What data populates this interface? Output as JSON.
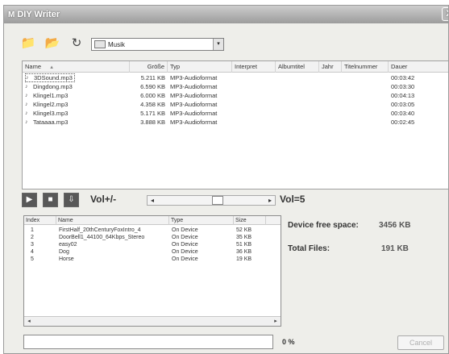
{
  "window": {
    "title": "DIY Writer",
    "app_icon": "M",
    "close": "X"
  },
  "toolbar": {
    "folder_combo_value": "Musik",
    "combo_arrow": "▾"
  },
  "file_list": {
    "columns": [
      "Name",
      "Größe",
      "Typ",
      "Interpret",
      "Albumtitel",
      "Jahr",
      "Titelnummer",
      "Dauer"
    ],
    "sort_indicator": "▲",
    "rows": [
      {
        "name": "3DSound.mp3",
        "size": "5.211 KB",
        "type": "MP3-Audioformat",
        "duration": "00:03:42"
      },
      {
        "name": "Dingdong.mp3",
        "size": "6.590 KB",
        "type": "MP3-Audioformat",
        "duration": "00:03:30"
      },
      {
        "name": "Klingel1.mp3",
        "size": "6.000 KB",
        "type": "MP3-Audioformat",
        "duration": "00:04:13"
      },
      {
        "name": "Klingel2.mp3",
        "size": "4.358 KB",
        "type": "MP3-Audioformat",
        "duration": "00:03:05"
      },
      {
        "name": "Klingel3.mp3",
        "size": "5.171 KB",
        "type": "MP3-Audioformat",
        "duration": "00:03:40"
      },
      {
        "name": "Tataaaa.mp3",
        "size": "3.888 KB",
        "type": "MP3-Audioformat",
        "duration": "00:02:45"
      }
    ]
  },
  "volume": {
    "label": "Vol+/-",
    "value_text": "Vol=5",
    "level": 5,
    "left_arrow": "◂",
    "right_arrow": "▸"
  },
  "device_list": {
    "columns": [
      "Index",
      "Name",
      "Type",
      "Size"
    ],
    "rows": [
      {
        "index": "1",
        "name": "FirstHalf_20thCenturyFoxIntro_4",
        "type": "On Device",
        "size": "52 KB"
      },
      {
        "index": "2",
        "name": "DoorBell1_44100_64Kbps_Stereo",
        "type": "On Device",
        "size": "35 KB"
      },
      {
        "index": "3",
        "name": "easy02",
        "type": "On Device",
        "size": "51 KB"
      },
      {
        "index": "4",
        "name": "Dog",
        "type": "On Device",
        "size": "36 KB"
      },
      {
        "index": "5",
        "name": "Horse",
        "type": "On Device",
        "size": "19 KB"
      }
    ]
  },
  "info": {
    "free_space_label": "Device free space:",
    "free_space_value": "3456 KB",
    "total_files_label": "Total Files:",
    "total_files_value": "191 KB"
  },
  "status": {
    "percent": "0 %",
    "progress": 0,
    "cancel_label": "Cancel"
  }
}
